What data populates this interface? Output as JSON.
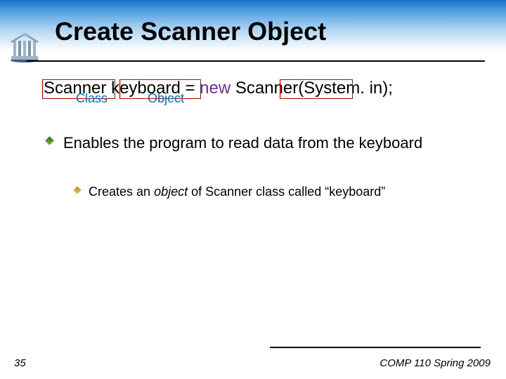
{
  "title": "Create Scanner Object",
  "code": {
    "part1": "Scanner",
    "space1": " ",
    "part2": "keyboard",
    "part3": " = ",
    "kw_new": "new",
    "space2": " ",
    "part4": "Scanner",
    "part5": "(System. in);"
  },
  "labels": {
    "class": "Class",
    "object": "Object"
  },
  "bullets": {
    "b1": "Enables the program to read data from the keyboard",
    "b2_pre": "Creates an ",
    "b2_em": "object",
    "b2_post": " of Scanner class called “keyboard”"
  },
  "footer": {
    "page": "35",
    "course": "COMP 110 Spring 2009"
  }
}
